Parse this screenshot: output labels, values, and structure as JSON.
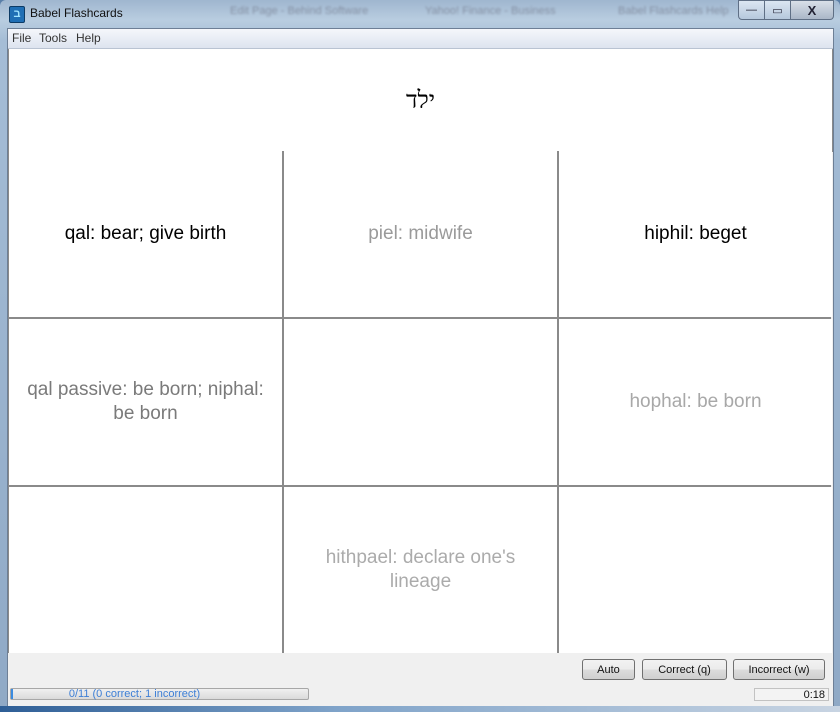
{
  "window": {
    "title": "Babel Flashcards",
    "app_icon_glyph": "ב",
    "background_tabs": [
      "Edit Page - Behind Software",
      "Yahoo! Finance - Business",
      "Babel Flashcards Help"
    ],
    "controls": {
      "minimize": "—",
      "maximize": "▭",
      "close": "X"
    }
  },
  "menubar": {
    "items": [
      "File",
      "Tools",
      "Help"
    ]
  },
  "prompt": {
    "word": "ילד"
  },
  "answers": [
    {
      "text": "qal: bear; give birth",
      "state": "active",
      "color": "#000000"
    },
    {
      "text": "piel: midwife",
      "state": "faded",
      "color": "#9a9a9a"
    },
    {
      "text": "hiphil: beget",
      "state": "active",
      "color": "#000000"
    },
    {
      "text": "qal passive: be born; niphal: be born",
      "state": "dim",
      "color": "#7a7a7a"
    },
    {
      "text": "",
      "state": "empty",
      "color": "#000000"
    },
    {
      "text": "hophal: be born",
      "state": "faded",
      "color": "#a8a8a8"
    },
    {
      "text": "",
      "state": "empty",
      "color": "#000000"
    },
    {
      "text": "hithpael: declare one's lineage",
      "state": "faded",
      "color": "#ababab"
    },
    {
      "text": "",
      "state": "empty",
      "color": "#000000"
    }
  ],
  "buttons": {
    "auto": "Auto",
    "correct": "Correct (q)",
    "incorrect": "Incorrect (w)"
  },
  "status": {
    "progress_text": "0/11 (0 correct; 1 incorrect)",
    "progress_fraction": 0.0,
    "timer": "0:18"
  },
  "colors": {
    "progress_text": "#3d7fd6",
    "grid_line": "#8a8a8a"
  }
}
